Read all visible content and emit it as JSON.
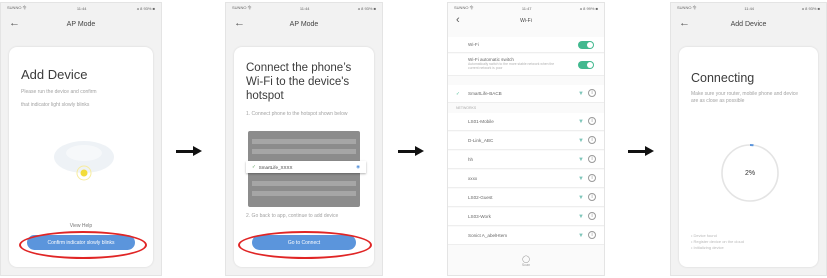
{
  "screens": [
    {
      "status": {
        "carrier": "SUNNO 令",
        "time": "11:44",
        "battery": "a 8 93% ■"
      },
      "nav_title": "AP Mode",
      "heading": "Add Device",
      "hints": [
        "Please run the device and confirm",
        "that indicator light slowly blinks"
      ],
      "link": "View Help",
      "button": "Confirm indicator slowly blinks"
    },
    {
      "status": {
        "carrier": "SUNNO 令",
        "time": "11:44",
        "battery": "a 8 93% ■"
      },
      "nav_title": "AP Mode",
      "heading": "Connect the phone’s Wi-Fi to the device's hotspot",
      "step": "1. Connect phone to the hotspot shown below",
      "mock_network": "SmartLife_XXXX",
      "step2": "2. Go back to app, continue to add device",
      "button": "Go to Connect"
    },
    {
      "status": {
        "carrier": "SUNNO 令",
        "time": "11:47",
        "battery": "a 8 99% ■"
      },
      "nav_title": "Wi-Fi",
      "wifi_label": "Wi-Fi",
      "auto_switch_label": "Wi-Fi automatic switch",
      "auto_switch_desc": "Automatically switch to the more stable network when the current network is poor",
      "connected_network": "SmartLife-BACB",
      "section_header": "NETWORKS",
      "networks": [
        "LS01-Mobile",
        "D-Link_ABC",
        "hh",
        "xxxx",
        "LS02-Guest",
        "LS03-Work",
        "Sonict A_abelHtem"
      ],
      "bottom_label": "Scan"
    },
    {
      "status": {
        "carrier": "SUNNO 令",
        "time": "11:44",
        "battery": "a 8 93% ■"
      },
      "nav_title": "Add Device",
      "heading": "Connecting",
      "hint": "Make sure your router, mobile phone and device are as close as possible",
      "progress": "2%",
      "progress_value": 0.02,
      "checklist": [
        "• Device found",
        "• Register device on the cloud",
        "• Initializing device"
      ]
    }
  ],
  "arrow_icon": "arrow-right-icon",
  "colors": {
    "accent_blue": "#5b95dc",
    "highlight_red": "#e02525",
    "toggle_green": "#41b98f",
    "text_dark": "#3b3b3b"
  }
}
